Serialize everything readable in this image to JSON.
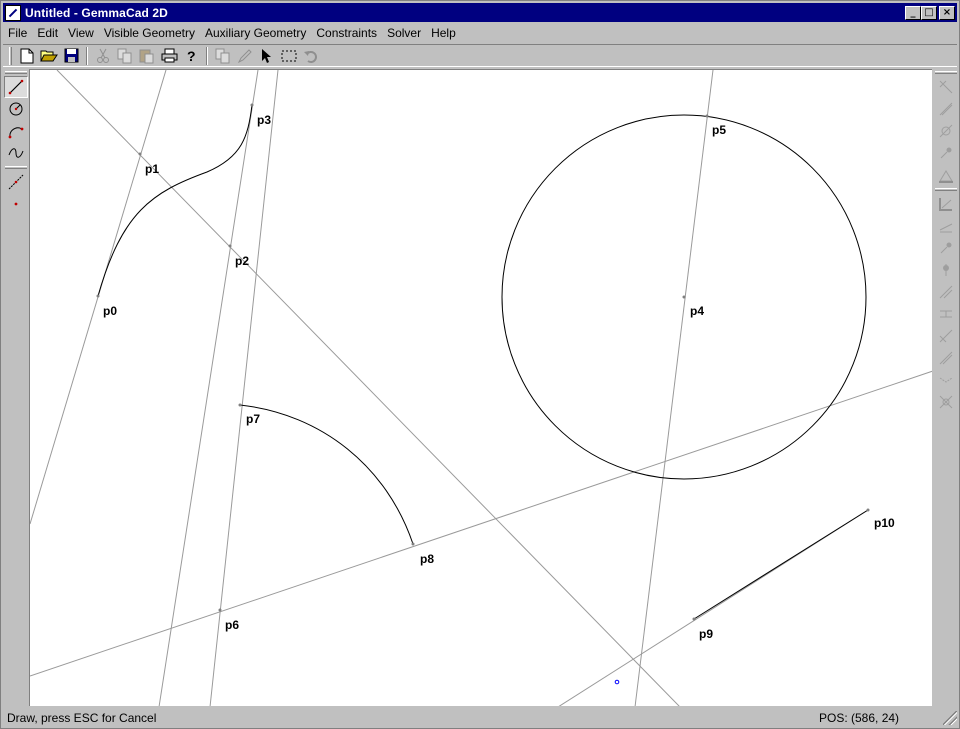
{
  "window": {
    "title": "Untitled - GemmaCad 2D"
  },
  "menu": {
    "items": [
      {
        "label": "File",
        "id": "file"
      },
      {
        "label": "Edit",
        "id": "edit"
      },
      {
        "label": "View",
        "id": "view"
      },
      {
        "label": "Visible Geometry",
        "id": "visible-geometry"
      },
      {
        "label": "Auxiliary Geometry",
        "id": "auxiliary-geometry"
      },
      {
        "label": "Constraints",
        "id": "constraints"
      },
      {
        "label": "Solver",
        "id": "solver"
      },
      {
        "label": "Help",
        "id": "help"
      }
    ]
  },
  "toolbar": {
    "icons": [
      "new-icon",
      "open-icon",
      "save-icon",
      "cut-icon",
      "copy-icon",
      "paste-icon",
      "print-icon",
      "help-icon",
      "copy-geometry-icon",
      "edit-pen-icon",
      "select-arrow-icon",
      "rect-select-icon",
      "undo-icon"
    ]
  },
  "left_toolbar": {
    "icons": [
      "line-tool-icon",
      "circle-tool-icon",
      "arc-tool-icon",
      "spline-tool-icon",
      "aux-line-tool-icon",
      "point-tool-icon"
    ]
  },
  "canvas": {
    "points": [
      {
        "label": "p0"
      },
      {
        "label": "p1"
      },
      {
        "label": "p2"
      },
      {
        "label": "p3"
      },
      {
        "label": "p4"
      },
      {
        "label": "p5"
      },
      {
        "label": "p6"
      },
      {
        "label": "p7"
      },
      {
        "label": "p8"
      },
      {
        "label": "p9"
      },
      {
        "label": "p10"
      }
    ]
  },
  "status": {
    "message": "Draw, press ESC for Cancel",
    "position": "POS:  (586, 24)"
  }
}
